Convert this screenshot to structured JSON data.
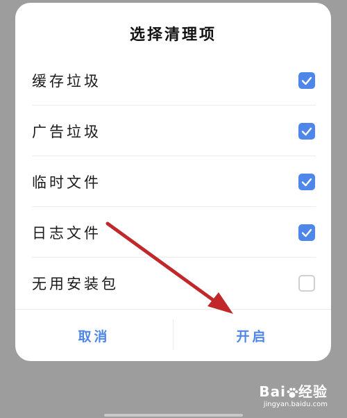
{
  "dialog": {
    "title": "选择清理项",
    "items": [
      {
        "label": "缓存垃圾",
        "checked": true
      },
      {
        "label": "广告垃圾",
        "checked": true
      },
      {
        "label": "临时文件",
        "checked": true
      },
      {
        "label": "日志文件",
        "checked": true
      },
      {
        "label": "无用安装包",
        "checked": false
      }
    ],
    "cancel_label": "取消",
    "confirm_label": "开启"
  },
  "colors": {
    "accent": "#4e86e9",
    "annotation_arrow": "#c0282a",
    "overlay": "#9d9d9d"
  },
  "watermark": {
    "brand_left": "Bai",
    "brand_right": "经验",
    "url": "jingyan.baidu.com"
  }
}
